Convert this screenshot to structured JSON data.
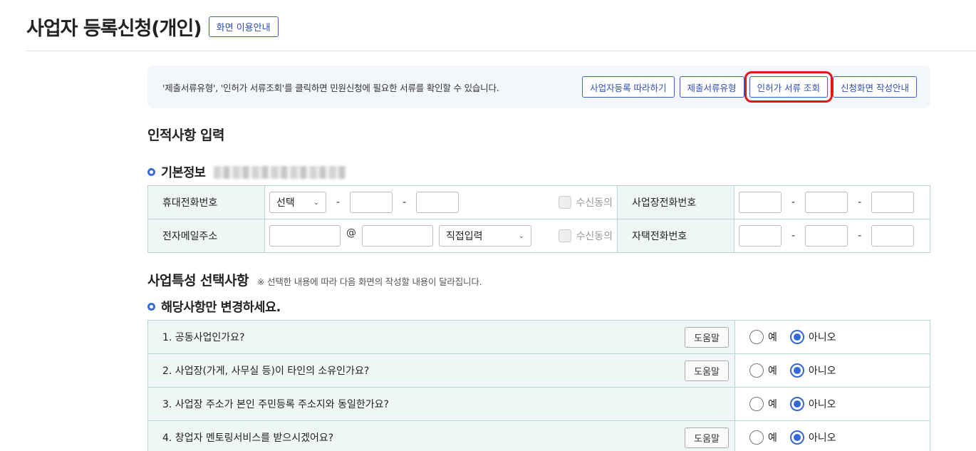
{
  "header": {
    "title": "사업자 등록신청(개인)",
    "guide_button": "화면 이용안내"
  },
  "notice": {
    "text": "'제출서류유형', '인허가 서류조회'를 클릭하면 민원신청에 필요한 서류를 확인할 수 있습니다.",
    "buttons": [
      "사업자등록 따라하기",
      "제출서류유형",
      "인허가 서류 조회",
      "신청화면 작성안내"
    ]
  },
  "personal": {
    "section_title": "인적사항 입력",
    "basic_info_title": "기본정보",
    "mobile_label": "휴대전화번호",
    "mobile_prefix_select": "선택",
    "consent_label": "수신동의",
    "biz_phone_label": "사업장전화번호",
    "email_label": "전자메일주소",
    "email_at": "@",
    "email_domain_select": "직접입력",
    "email_consent_label": "수신동의",
    "home_phone_label": "자택전화번호",
    "dash": "-"
  },
  "business": {
    "section_title": "사업특성 선택사항",
    "section_note": "※ 선택한 내용에 따라 다음 화면의 작성할 내용이 달라집니다.",
    "change_title": "해당사항만 변경하세요.",
    "help_label": "도움말",
    "yes_label": "예",
    "no_label": "아니오",
    "questions": [
      {
        "text": "1. 공동사업인가요?",
        "has_help": true,
        "answer": "아니오"
      },
      {
        "text": "2. 사업장(가게, 사무실 등)이 타인의 소유인가요?",
        "has_help": true,
        "answer": "아니오"
      },
      {
        "text": "3. 사업장 주소가 본인 주민등록 주소지와 동일한가요?",
        "has_help": false,
        "answer": "아니오"
      },
      {
        "text": "4. 창업자 멘토링서비스를 받으시겠어요?",
        "has_help": true,
        "answer": "아니오"
      }
    ]
  },
  "colors": {
    "accent": "#3c5fc3",
    "highlight": "#e2161a",
    "label_bg": "#eef6f6",
    "border": "#b9d5d8"
  }
}
